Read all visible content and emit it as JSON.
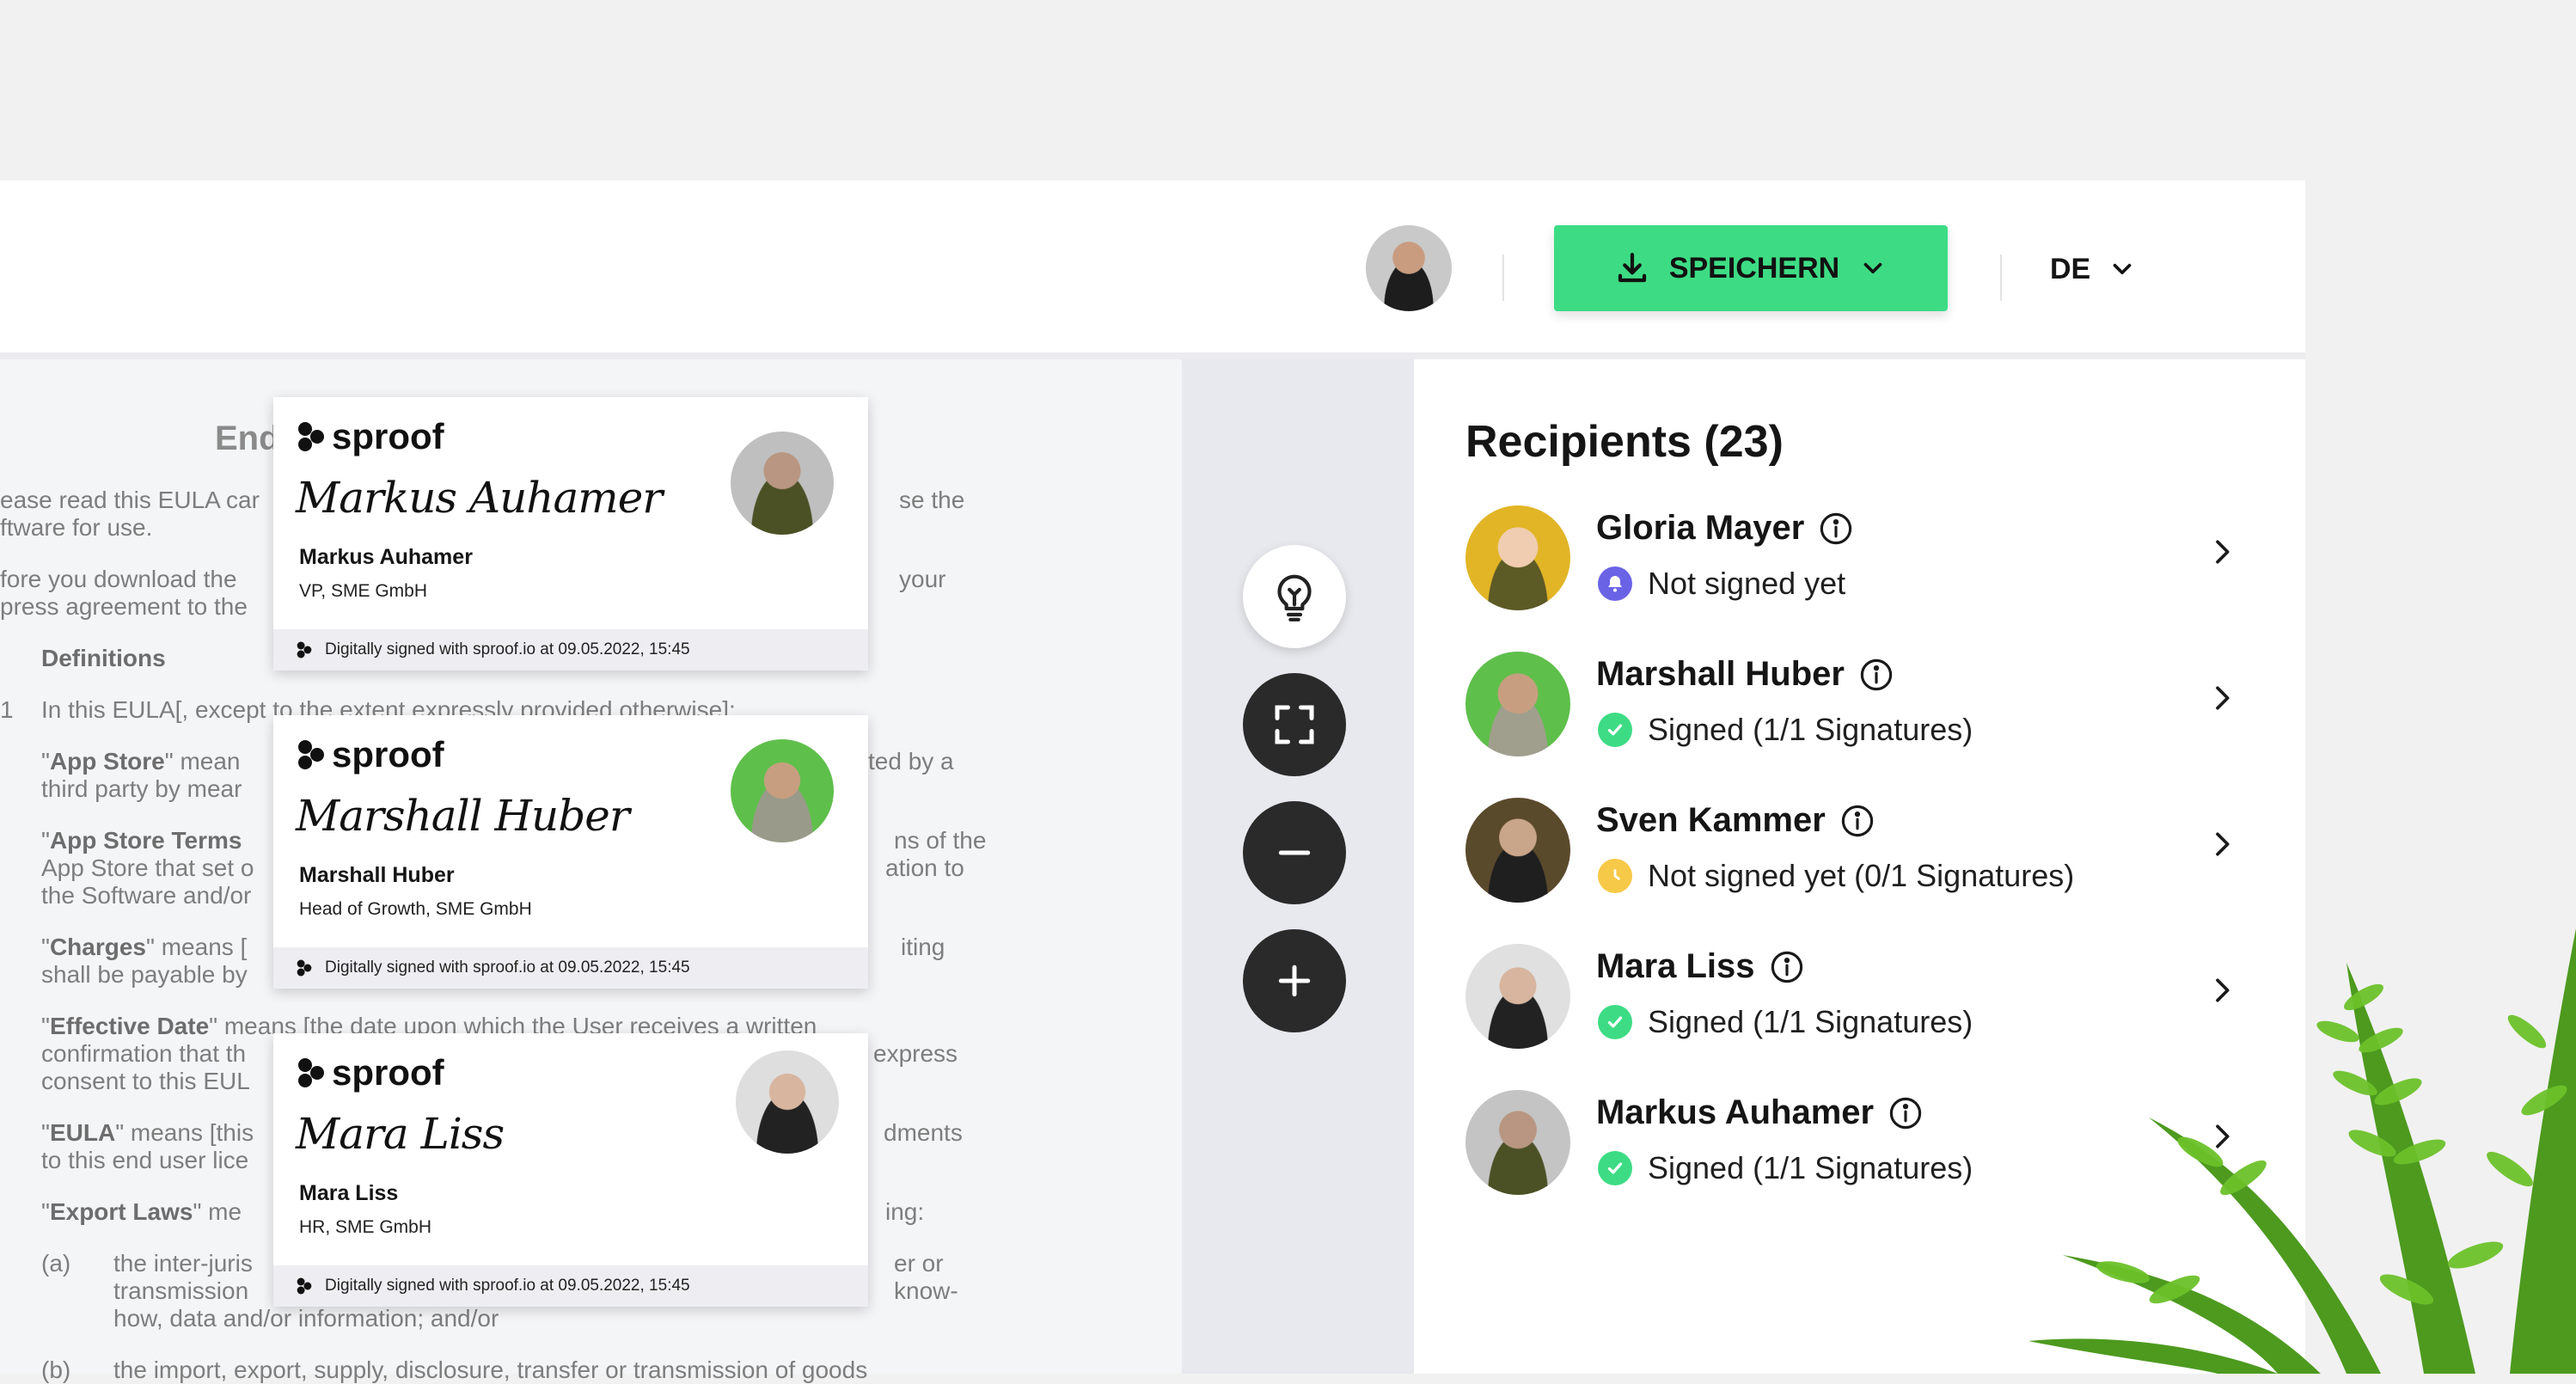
{
  "header": {
    "save_label": "SPEICHERN",
    "language": "DE"
  },
  "document": {
    "title_fragment": "End",
    "lines": [
      {
        "a": "ease read this EULA car",
        "b": "se the"
      },
      {
        "a": "ftware for use.",
        "b": ""
      },
      {
        "a": "fore you download the",
        "b": "your"
      },
      {
        "a": "press agreement to the",
        "b": ""
      }
    ],
    "definitions_heading": "Definitions",
    "numbered_marker": "1",
    "numbered_line": "In this EULA[, except to the extent expressly provided otherwise]:",
    "terms": [
      {
        "quote_open": "\"",
        "term": "App Store",
        "rest": "\" mean",
        "right": "ted by a",
        "line2": "third party by mear"
      },
      {
        "quote_open": "\"",
        "term": "App Store Terms",
        "rest": "",
        "right": "ns of the",
        "line2": "App Store that set o",
        "right2": "ation to",
        "line3": "the Software and/or"
      },
      {
        "quote_open": "\"",
        "term": "Charges",
        "rest": "\" means [",
        "right": "iting",
        "line2": "shall be payable by"
      },
      {
        "quote_open": "\"",
        "term": "Effective Date",
        "rest": "\" means [the date upon which the User receives a written",
        "line2": "confirmation that th",
        "right2": "express",
        "line3": "consent to this EUL"
      },
      {
        "quote_open": "\"",
        "term": "EULA",
        "rest": "\" means [this",
        "right": "dments",
        "line2": "to this end user lice"
      },
      {
        "quote_open": "\"",
        "term": "Export Laws",
        "rest": "\" me",
        "right": "ing:"
      }
    ],
    "list_a_marker": "(a)",
    "list_a_line1": "the inter-juris",
    "list_a_right1": "er or",
    "list_a_line2": "transmission",
    "list_a_right2": "know-",
    "list_a_line3": "how, data and/or information; and/or",
    "list_b_marker": "(b)",
    "list_b_line1": "the import, export, supply, disclosure, transfer or transmission of goods"
  },
  "signature_cards": [
    {
      "brand": "sproof",
      "script": "Markus Auhamer",
      "name": "Markus Auhamer",
      "role": "VP, SME GmbH",
      "footer": "Digitally signed with sproof.io at 09.05.2022, 15:45"
    },
    {
      "brand": "sproof",
      "script": "Marshall Huber",
      "name": "Marshall Huber",
      "role": "Head of Growth, SME GmbH",
      "footer": "Digitally signed with sproof.io at 09.05.2022, 15:45"
    },
    {
      "brand": "sproof",
      "script": "Mara Liss",
      "name": "Mara Liss",
      "role": "HR, SME GmbH",
      "footer": "Digitally signed with sproof.io at 09.05.2022, 15:45"
    }
  ],
  "recipients": {
    "title": "Recipients (23)",
    "items": [
      {
        "name": "Gloria Mayer",
        "status": "Not signed yet",
        "status_icon": "bell-icon",
        "status_color": "#6b63e6"
      },
      {
        "name": "Marshall Huber",
        "status": "Signed (1/1 Signatures)",
        "status_icon": "check-icon",
        "status_color": "#3ddc84"
      },
      {
        "name": "Sven Kammer",
        "status": "Not signed yet (0/1 Signatures)",
        "status_icon": "clock-icon",
        "status_color": "#f7c948"
      },
      {
        "name": "Mara Liss",
        "status": "Signed (1/1 Signatures)",
        "status_icon": "check-icon",
        "status_color": "#3ddc84"
      },
      {
        "name": "Markus Auhamer",
        "status": "Signed (1/1 Signatures)",
        "status_icon": "check-icon",
        "status_color": "#3ddc84"
      }
    ]
  },
  "colors": {
    "accent_green": "#3ddc84",
    "dark_control": "#2a2a2a",
    "pending_purple": "#6b63e6",
    "pending_yellow": "#f7c948"
  }
}
